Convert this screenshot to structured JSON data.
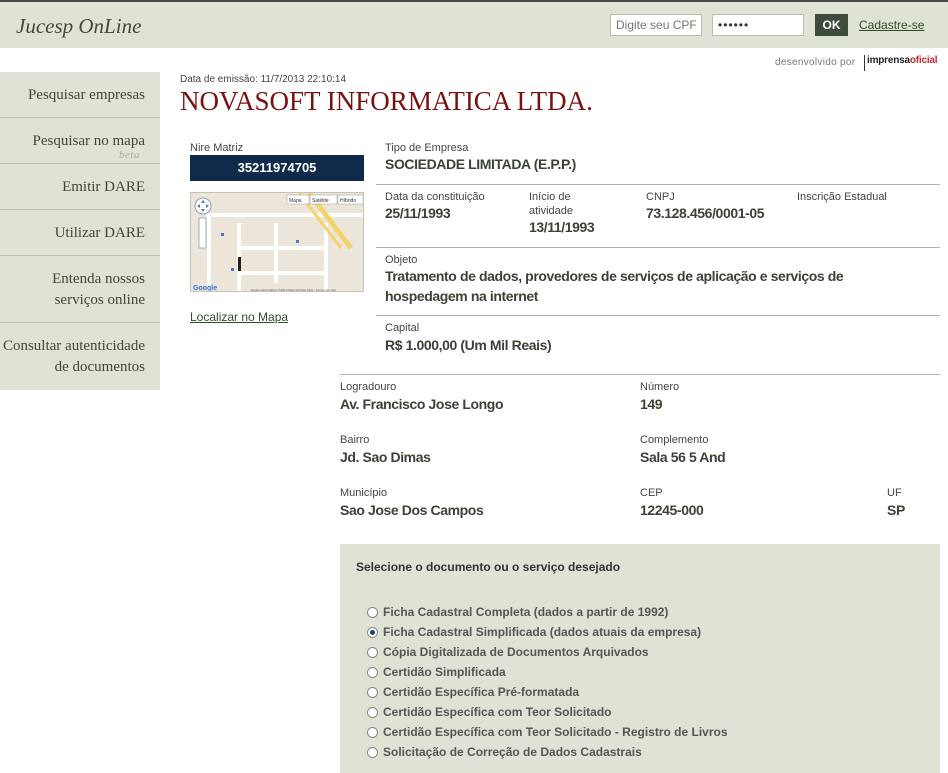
{
  "header": {
    "logo": "Jucesp OnLine",
    "cpf_placeholder": "Digite seu CPF",
    "password_mask": "••••••",
    "ok_label": "OK",
    "signup_label": "Cadastre-se",
    "developed_by": "desenvolvido por",
    "brand_a": "imprensa",
    "brand_b": "oficial"
  },
  "sidebar": {
    "items": [
      {
        "label": "Pesquisar empresas"
      },
      {
        "label": "Pesquisar no mapa",
        "badge": "beta"
      },
      {
        "label": "Emitir DARE"
      },
      {
        "label": "Utilizar DARE"
      },
      {
        "label_line1": "Entenda nossos",
        "label_line2": "serviços online"
      },
      {
        "label_line1": "Consultar autenticidade",
        "label_line2": "de documentos"
      }
    ]
  },
  "company": {
    "emission": "Data de emissão: 11/7/2013 22:10:14",
    "name": "NOVASOFT INFORMATICA LTDA.",
    "nire_label": "Nire Matriz",
    "nire": "35211974705",
    "map_link": "Localizar no Mapa",
    "map": {
      "btn_map": "Mapa",
      "btn_sat": "Satélite",
      "btn_hyb": "Híbrido",
      "footer": "Dados cartográficos ©2013 MapLink/Tele Atlas - Termos de Uso"
    },
    "tipo_label": "Tipo de Empresa",
    "tipo": "SOCIEDADE LIMITADA (E.P.P.)",
    "constituicao_label": "Data da constituição",
    "constituicao": "25/11/1993",
    "inicio_label_1": "Início de",
    "inicio_label_2": "atividade",
    "inicio": "13/11/1993",
    "cnpj_label": "CNPJ",
    "cnpj": "73.128.456/0001-05",
    "ie_label": "Inscrição Estadual",
    "ie": "",
    "objeto_label": "Objeto",
    "objeto_line1": "Tratamento de dados, provedores de serviços de aplicação e serviços de",
    "objeto_line2": "hospedagem na internet",
    "capital_label": "Capital",
    "capital": "R$ 1.000,00 (Um Mil Reais)"
  },
  "address": {
    "logradouro_label": "Logradouro",
    "logradouro": "Av. Francisco Jose Longo",
    "numero_label": "Número",
    "numero": "149",
    "bairro_label": "Bairro",
    "bairro": "Jd. Sao Dimas",
    "complemento_label": "Complemento",
    "complemento": "Sala 56 5 And",
    "municipio_label": "Município",
    "municipio": "Sao Jose Dos Campos",
    "cep_label": "CEP",
    "cep": "12245-000",
    "uf_label": "UF",
    "uf": "SP"
  },
  "services": {
    "title": "Selecione o documento ou o serviço desejado",
    "selected_index": 1,
    "options": [
      "Ficha Cadastral Completa (dados a partir de 1992)",
      "Ficha Cadastral Simplificada (dados atuais da empresa)",
      "Cópia Digitalizada de Documentos Arquivados",
      "Certidão Simplificada",
      "Certidão Específica Pré-formatada",
      "Certidão Específica com Teor Solicitado",
      "Certidão Específica com Teor Solicitado - Registro de Livros",
      "Solicitação de Correção de Dados Cadastrais"
    ]
  }
}
